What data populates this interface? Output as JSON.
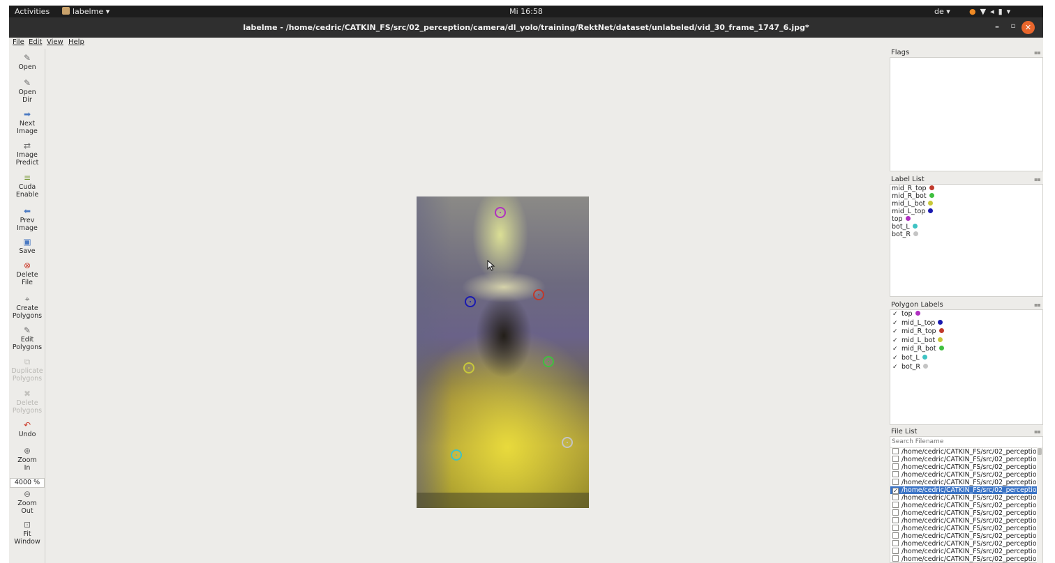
{
  "system": {
    "activities": "Activities",
    "app_name": "labelme",
    "clock": "Mi 16:58",
    "language": "de"
  },
  "window": {
    "title": "labelme - /home/cedric/CATKIN_FS/src/02_perception/camera/dl_yolo/training/RektNet/dataset/unlabeled/vid_30_frame_1747_6.jpg*"
  },
  "menubar": [
    "File",
    "Edit",
    "View",
    "Help"
  ],
  "toolbar": {
    "open": "Open",
    "open_dir": [
      "Open",
      "Dir"
    ],
    "next_image": [
      "Next",
      "Image"
    ],
    "image_predict": [
      "Image",
      "Predict"
    ],
    "cuda_enable": [
      "Cuda",
      "Enable"
    ],
    "prev_image": [
      "Prev",
      "Image"
    ],
    "save": "Save",
    "delete_file": [
      "Delete",
      "File"
    ],
    "create_polygons": [
      "Create",
      "Polygons"
    ],
    "edit_polygons": [
      "Edit",
      "Polygons"
    ],
    "duplicate_polygons": [
      "Duplicate",
      "Polygons"
    ],
    "delete_polygons": [
      "Delete",
      "Polygons"
    ],
    "undo": "Undo",
    "zoom_in": [
      "Zoom",
      "In"
    ],
    "zoom_value": "4000 %",
    "zoom_out": [
      "Zoom",
      "Out"
    ],
    "fit_window": [
      "Fit",
      "Window"
    ]
  },
  "docks": {
    "flags_title": "Flags",
    "label_list_title": "Label List",
    "polygon_labels_title": "Polygon Labels",
    "file_list_title": "File List"
  },
  "label_list": [
    {
      "label": "mid_R_top",
      "color": "#c0392b"
    },
    {
      "label": "mid_R_bot",
      "color": "#3fbf3f"
    },
    {
      "label": "mid_L_bot",
      "color": "#c8c83a"
    },
    {
      "label": "mid_L_top",
      "color": "#1a1ab0"
    },
    {
      "label": "top",
      "color": "#b030c0"
    },
    {
      "label": "bot_L",
      "color": "#3ec3c3"
    },
    {
      "label": "bot_R",
      "color": "#c4c4c4"
    }
  ],
  "polygon_labels": [
    {
      "label": "top",
      "checked": true,
      "color": "#b030c0"
    },
    {
      "label": "mid_L_top",
      "checked": true,
      "color": "#1a1ab0"
    },
    {
      "label": "mid_R_top",
      "checked": true,
      "color": "#c0392b"
    },
    {
      "label": "mid_L_bot",
      "checked": true,
      "color": "#c8c83a"
    },
    {
      "label": "mid_R_bot",
      "checked": true,
      "color": "#3fbf3f"
    },
    {
      "label": "bot_L",
      "checked": true,
      "color": "#3ec3c3"
    },
    {
      "label": "bot_R",
      "checked": true,
      "color": "#c4c4c4"
    }
  ],
  "keypoints": [
    {
      "label": "top",
      "color": "#b030c0"
    },
    {
      "label": "mid_L_top",
      "color": "#1a1ab0"
    },
    {
      "label": "mid_R_top",
      "color": "#c0392b"
    },
    {
      "label": "mid_L_bot",
      "color": "#c8c83a"
    },
    {
      "label": "mid_R_bot",
      "color": "#3fbf3f"
    },
    {
      "label": "bot_L",
      "color": "#3ec3c3"
    },
    {
      "label": "bot_R",
      "color": "#c4c4c4"
    }
  ],
  "file_list": {
    "search_placeholder": "Search Filename",
    "items": [
      {
        "path": "/home/cedric/CATKIN_FS/src/02_perceptio",
        "checked": false,
        "selected": false
      },
      {
        "path": "/home/cedric/CATKIN_FS/src/02_perceptio",
        "checked": false,
        "selected": false
      },
      {
        "path": "/home/cedric/CATKIN_FS/src/02_perceptio",
        "checked": false,
        "selected": false
      },
      {
        "path": "/home/cedric/CATKIN_FS/src/02_perceptio",
        "checked": false,
        "selected": false
      },
      {
        "path": "/home/cedric/CATKIN_FS/src/02_perceptio",
        "checked": false,
        "selected": false
      },
      {
        "path": "/home/cedric/CATKIN_FS/src/02_perceptio",
        "checked": true,
        "selected": true
      },
      {
        "path": "/home/cedric/CATKIN_FS/src/02_perceptio",
        "checked": false,
        "selected": false
      },
      {
        "path": "/home/cedric/CATKIN_FS/src/02_perceptio",
        "checked": false,
        "selected": false
      },
      {
        "path": "/home/cedric/CATKIN_FS/src/02_perceptio",
        "checked": false,
        "selected": false
      },
      {
        "path": "/home/cedric/CATKIN_FS/src/02_perceptio",
        "checked": false,
        "selected": false
      },
      {
        "path": "/home/cedric/CATKIN_FS/src/02_perceptio",
        "checked": false,
        "selected": false
      },
      {
        "path": "/home/cedric/CATKIN_FS/src/02_perceptio",
        "checked": false,
        "selected": false
      },
      {
        "path": "/home/cedric/CATKIN_FS/src/02_perceptio",
        "checked": false,
        "selected": false
      },
      {
        "path": "/home/cedric/CATKIN_FS/src/02_perceptio",
        "checked": false,
        "selected": false
      },
      {
        "path": "/home/cedric/CATKIN_FS/src/02_perceptio",
        "checked": false,
        "selected": false
      }
    ]
  },
  "colors": {
    "selection": "#3b74c6",
    "close_button": "#e9662c"
  }
}
